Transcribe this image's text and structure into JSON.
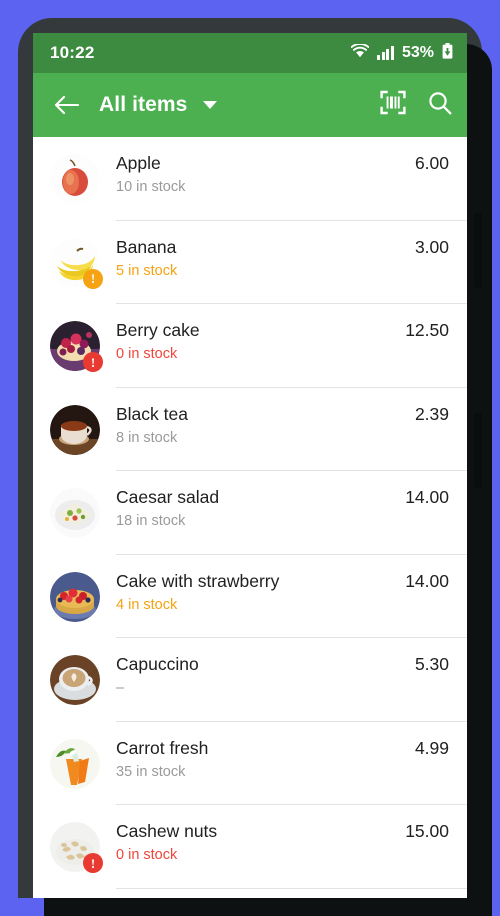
{
  "status_bar": {
    "time": "10:22",
    "battery_percent": "53%",
    "icons": [
      "wifi-icon",
      "cellular-signal-icon",
      "battery-icon"
    ],
    "background_color": "#3d8b40"
  },
  "app_bar": {
    "back_label": "back-arrow",
    "title": "All items",
    "dropdown_label": "category-dropdown",
    "scan_label": "barcode-scan",
    "search_label": "search",
    "background_color": "#4caf50"
  },
  "colors": {
    "accent_green": "#4caf50",
    "status_green": "#3d8b40",
    "low_stock": "#F5A213",
    "out_of_stock": "#F0463C",
    "normal_stock": "#9a9a9a",
    "page_background": "#5C63F0"
  },
  "items": [
    {
      "name": "Apple",
      "stock": "10 in stock",
      "price": "6.00",
      "state": "normal",
      "badge": "none",
      "image": "apple"
    },
    {
      "name": "Banana",
      "stock": "5 in stock",
      "price": "3.00",
      "state": "low",
      "badge": "low",
      "image": "banana"
    },
    {
      "name": "Berry cake",
      "stock": "0 in stock",
      "price": "12.50",
      "state": "out",
      "badge": "out",
      "image": "berrycake"
    },
    {
      "name": "Black tea",
      "stock": "8  in stock",
      "price": "2.39",
      "state": "normal",
      "badge": "none",
      "image": "blacktea"
    },
    {
      "name": "Caesar salad",
      "stock": "18 in stock",
      "price": "14.00",
      "state": "normal",
      "badge": "none",
      "image": "caesarsalad"
    },
    {
      "name": "Cake with strawberry",
      "stock": "4 in stock",
      "price": "14.00",
      "state": "low",
      "badge": "none",
      "image": "strawberrycake"
    },
    {
      "name": "Capuccino",
      "stock": "–",
      "price": "5.30",
      "state": "normal",
      "badge": "none",
      "image": "capuccino"
    },
    {
      "name": "Carrot fresh",
      "stock": "35 in stock",
      "price": "4.99",
      "state": "normal",
      "badge": "none",
      "image": "carrotfresh"
    },
    {
      "name": "Cashew nuts",
      "stock": "0 in stock",
      "price": "15.00",
      "state": "out",
      "badge": "out",
      "image": "cashewnuts"
    }
  ]
}
